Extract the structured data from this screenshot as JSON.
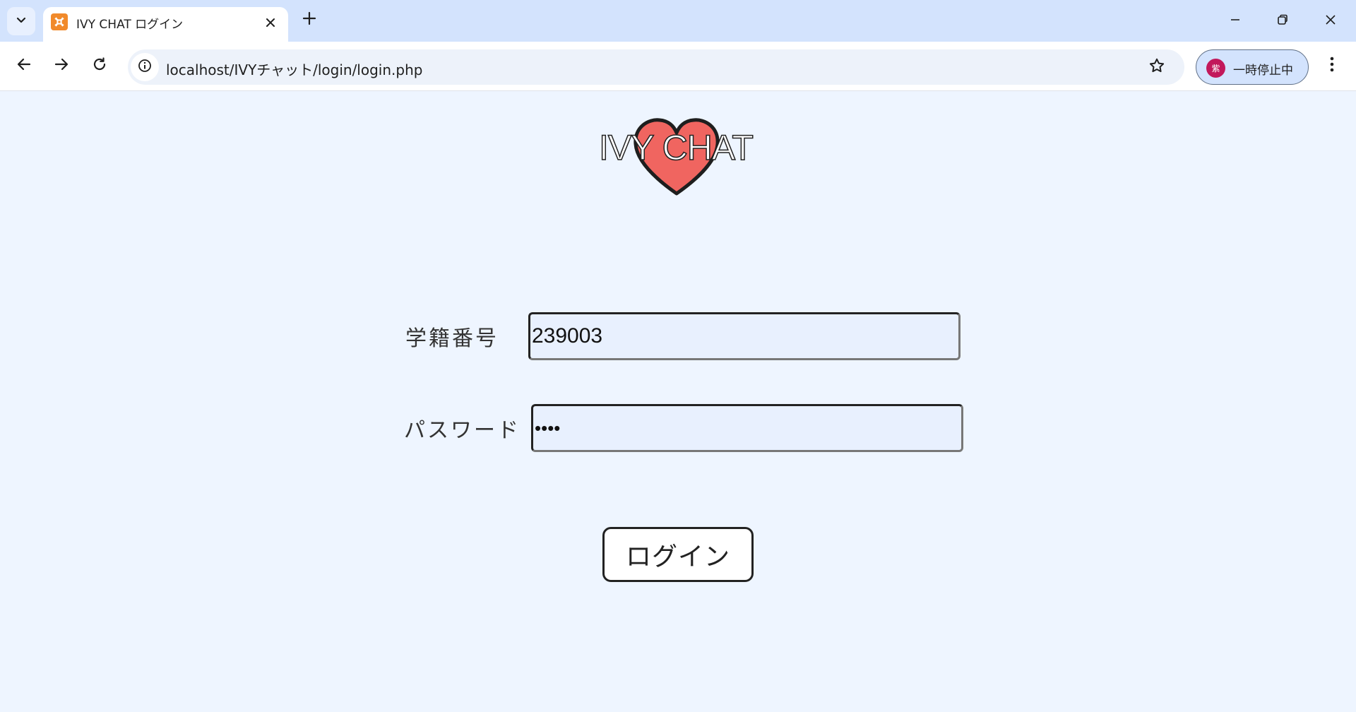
{
  "browser": {
    "tab_title": "IVY CHAT ログイン",
    "url": "localhost/IVYチャット/login/login.php",
    "profile_avatar_text": "紫",
    "profile_label": "一時停止中"
  },
  "page": {
    "logo_text": "IVY CHAT",
    "heart_color": "#f06560",
    "student_id_label": "学籍番号",
    "student_id_value": "239003",
    "password_label": "パスワード",
    "password_value": "••••",
    "login_button_label": "ログイン"
  }
}
